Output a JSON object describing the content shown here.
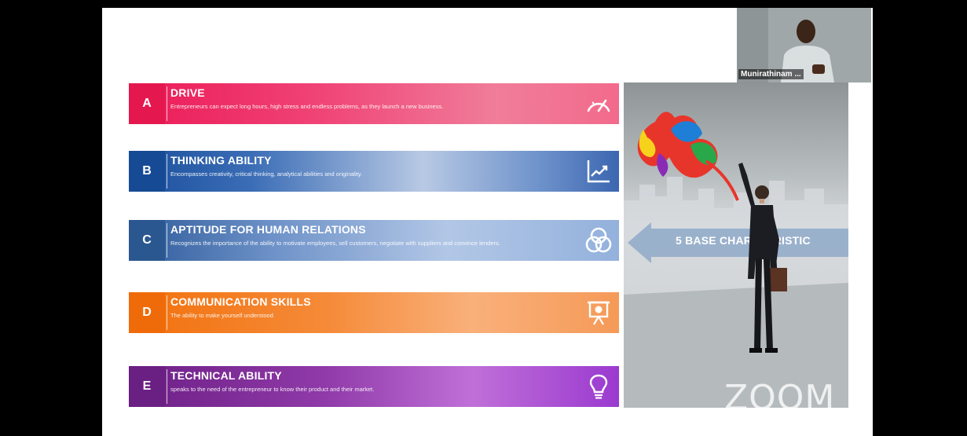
{
  "slide": {
    "rows": [
      {
        "letter": "A",
        "title": "DRIVE",
        "description": "Entrepreneurs can expect long hours, high stress and endless problems, as they launch a new business.",
        "icon": "speedometer-icon",
        "color": "#ec1a57"
      },
      {
        "letter": "B",
        "title": "THINKING ABILITY",
        "description": "Encompasses creativity, critical thinking, analytical abilities and originality.",
        "icon": "trend-chart-icon",
        "color": "#1a4f9c"
      },
      {
        "letter": "C",
        "title": "APTITUDE FOR HUMAN RELATIONS",
        "description": "Recognizes the importance of the ability to motivate employees, sell customers, negotiate with suppliers and convince lenders.",
        "icon": "overlapping-circles-icon",
        "color": "#2d5a9a"
      },
      {
        "letter": "D",
        "title": "COMMUNICATION SKILLS",
        "description": "The ability to make yourself understood",
        "icon": "presentation-board-icon",
        "color": "#f2710d"
      },
      {
        "letter": "E",
        "title": "TECHNICAL ABILITY",
        "description": " speaks to the need of the entrepreneur to know their product and their market.",
        "icon": "lightbulb-icon",
        "color": "#6d1f86"
      }
    ],
    "side_label": "5 BASE CHARATERISTIC",
    "watermark": "ZOOM"
  },
  "participant": {
    "name": "Munirathinam ..."
  }
}
